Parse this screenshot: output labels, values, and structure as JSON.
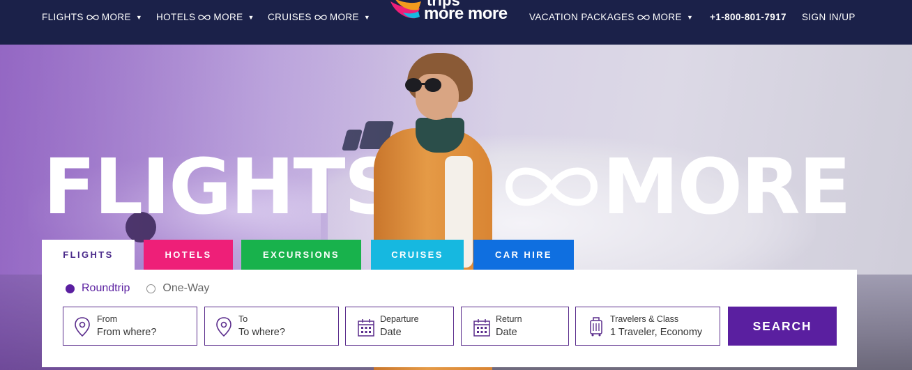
{
  "header": {
    "nav_left": [
      {
        "label": "FLIGHTS",
        "suffix": "MORE"
      },
      {
        "label": "HOTELS",
        "suffix": "MORE"
      },
      {
        "label": "CRUISES",
        "suffix": "MORE"
      }
    ],
    "logo": {
      "line1": "trips",
      "line2": "more more"
    },
    "nav_right": {
      "packages": {
        "label": "VACATION PACKAGES",
        "suffix": "MORE"
      }
    },
    "phone": "+1-800-801-7917",
    "signin": "SIGN IN/UP"
  },
  "hero": {
    "title_left": "FLIGHTS",
    "title_right": "MORE"
  },
  "tabs": [
    {
      "label": "FLIGHTS",
      "color": "#ffffff",
      "active": true
    },
    {
      "label": "HOTELS",
      "color": "#ee1f78"
    },
    {
      "label": "EXCURSIONS",
      "color": "#18b24c"
    },
    {
      "label": "CRUISES",
      "color": "#16b8e0"
    },
    {
      "label": "CAR HIRE",
      "color": "#0f6fe0"
    }
  ],
  "search": {
    "trip_types": [
      {
        "label": "Roundtrip",
        "selected": true
      },
      {
        "label": "One-Way",
        "selected": false
      }
    ],
    "fields": {
      "from": {
        "label": "From",
        "value": "From where?",
        "icon": "map-pin-icon"
      },
      "to": {
        "label": "To",
        "value": "To where?",
        "icon": "map-pin-icon"
      },
      "departure": {
        "label": "Departure",
        "value": "Date",
        "icon": "calendar-icon"
      },
      "return": {
        "label": "Return",
        "value": "Date",
        "icon": "calendar-icon"
      },
      "travelers": {
        "label": "Travelers & Class",
        "value": "1 Traveler, Economy",
        "icon": "luggage-icon"
      }
    },
    "button": "SEARCH"
  },
  "colors": {
    "header_bg": "#1b2149",
    "accent": "#5a1fa0"
  }
}
